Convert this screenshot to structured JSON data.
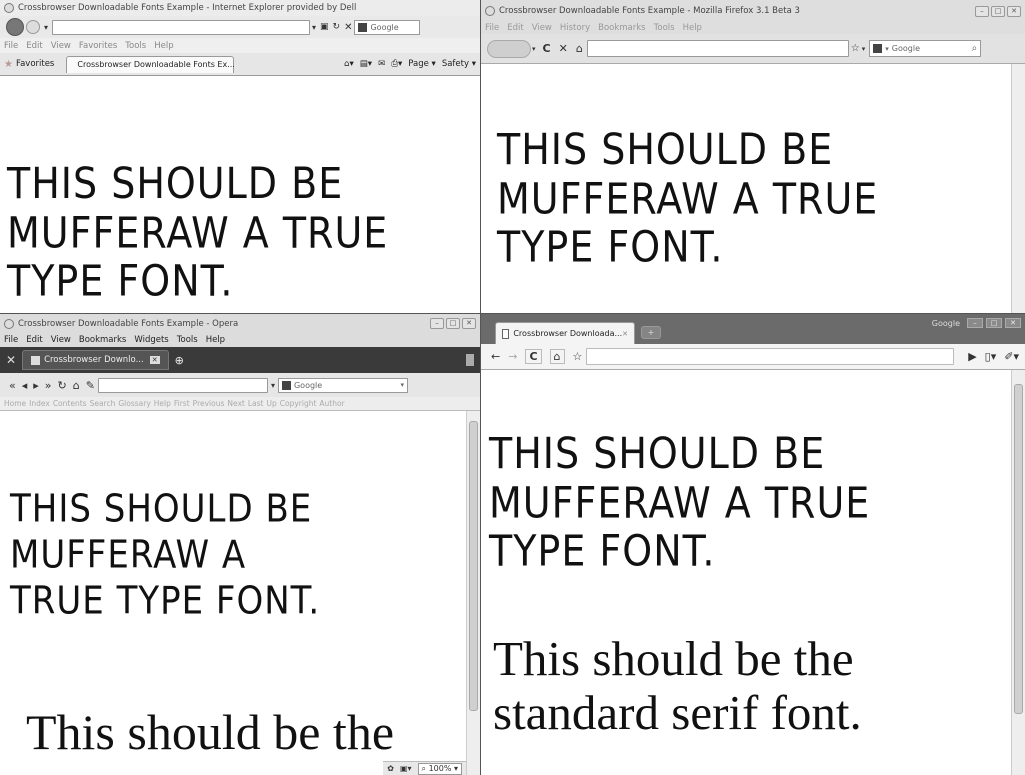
{
  "ie": {
    "title": "Crossbrowser Downloadable Fonts Example - Internet Explorer provided by Dell",
    "search_placeholder": "Google",
    "menu": [
      "File",
      "Edit",
      "View",
      "Favorites",
      "Tools",
      "Help"
    ],
    "favorites_label": "Favorites",
    "tab_label": "Crossbrowser Downloadable Fonts Ex...",
    "cmd_page": "Page",
    "cmd_safety": "Safety",
    "heading": [
      "THIS SHOULD BE",
      "MUFFERAW A TRUE",
      "TYPE FONT."
    ]
  },
  "firefox": {
    "title": "Crossbrowser Downloadable Fonts Example - Mozilla Firefox 3.1 Beta 3",
    "menu": [
      "File",
      "Edit",
      "View",
      "History",
      "Bookmarks",
      "Tools",
      "Help"
    ],
    "search_placeholder": "Google",
    "heading": [
      "THIS SHOULD BE",
      "MUFFERAW A TRUE",
      "TYPE FONT."
    ]
  },
  "opera": {
    "title": "Crossbrowser Downloadable Fonts Example - Opera",
    "menu": [
      "File",
      "Edit",
      "View",
      "Bookmarks",
      "Widgets",
      "Tools",
      "Help"
    ],
    "tab_label": "Crossbrowser Downlo...",
    "search_placeholder": "Google",
    "nav_links": [
      "Home",
      "Index",
      "Contents",
      "Search",
      "Glossary",
      "Help",
      "First",
      "Previous",
      "Next",
      "Last",
      "Up",
      "Copyright",
      "Author"
    ],
    "zoom": "100%",
    "heading": [
      "THIS SHOULD BE",
      "MUFFERAW A",
      "TRUE TYPE FONT."
    ],
    "serif_text": "This should be the"
  },
  "chrome": {
    "tab_label": "Crossbrowser Downloada...",
    "search_label": "Google",
    "heading": [
      "THIS SHOULD BE",
      "MUFFERAW A TRUE",
      "TYPE FONT."
    ],
    "serif_text": [
      "This should be the",
      "standard serif font."
    ]
  },
  "icons": {
    "back": "back-icon",
    "forward": "forward-icon",
    "reload": "reload-icon",
    "stop": "stop-icon",
    "home": "home-icon",
    "star": "star-icon",
    "page": "page-icon",
    "wrench": "wrench-icon"
  }
}
